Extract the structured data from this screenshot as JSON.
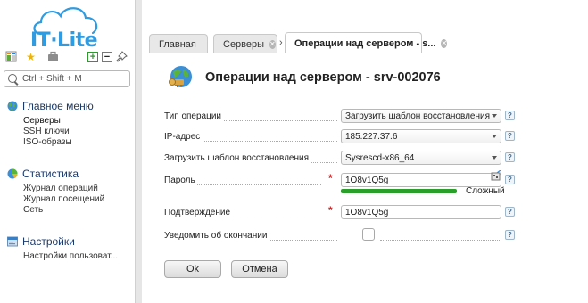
{
  "app": {
    "logo_text": "IT·Lite",
    "accent": "#2f9be0"
  },
  "search": {
    "placeholder": "Ctrl + Shift + M"
  },
  "sidebar": {
    "sections": [
      {
        "title": "Главное меню",
        "icon": "globe-icon",
        "items": [
          "Серверы",
          "SSH ключи",
          "ISO-образы"
        ]
      },
      {
        "title": "Статистика",
        "icon": "pie-chart-icon",
        "items": [
          "Журнал операций",
          "Журнал посещений",
          "Сеть"
        ]
      },
      {
        "title": "Настройки",
        "icon": "settings-window-icon",
        "items": [
          "Настройки пользоват..."
        ]
      }
    ]
  },
  "tabs": [
    {
      "label": "Главная",
      "closable": false
    },
    {
      "label": "Серверы",
      "closable": true
    },
    {
      "label": "Операции над сервером - s...",
      "closable": true,
      "active": true
    }
  ],
  "page": {
    "title": "Операции над сервером - srv-002076",
    "icon": "globe-key-icon"
  },
  "form": {
    "operation_type": {
      "label": "Тип операции",
      "value": "Загрузить шаблон восстановления"
    },
    "ip_address": {
      "label": "IP-адрес",
      "value": "185.227.37.6"
    },
    "template": {
      "label": "Загрузить шаблон восстановления",
      "value": "Sysrescd-x86_64"
    },
    "password": {
      "label": "Пароль",
      "value": "1O8v1Q5g",
      "strength_label": "Сложный",
      "strength": 1.0,
      "strength_color": "#2aa02a"
    },
    "confirm": {
      "label": "Подтверждение",
      "value": "1O8v1Q5g"
    },
    "notify": {
      "label": "Уведомить об окончании",
      "checked": false
    },
    "help_glyph": "?"
  },
  "buttons": {
    "ok": "Ok",
    "cancel": "Отмена"
  }
}
